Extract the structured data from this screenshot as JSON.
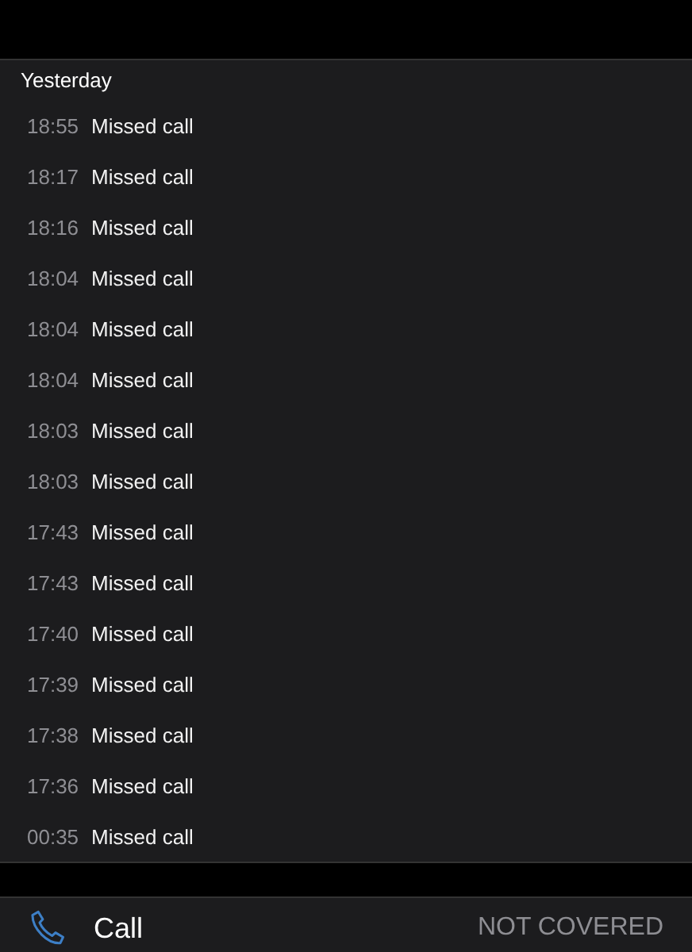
{
  "section": {
    "title": "Yesterday",
    "calls": [
      {
        "time": "18:55",
        "label": "Missed call"
      },
      {
        "time": "18:17",
        "label": "Missed call"
      },
      {
        "time": "18:16",
        "label": "Missed call"
      },
      {
        "time": "18:04",
        "label": "Missed call"
      },
      {
        "time": "18:04",
        "label": "Missed call"
      },
      {
        "time": "18:04",
        "label": "Missed call"
      },
      {
        "time": "18:03",
        "label": "Missed call"
      },
      {
        "time": "18:03",
        "label": "Missed call"
      },
      {
        "time": "17:43",
        "label": "Missed call"
      },
      {
        "time": "17:43",
        "label": "Missed call"
      },
      {
        "time": "17:40",
        "label": "Missed call"
      },
      {
        "time": "17:39",
        "label": "Missed call"
      },
      {
        "time": "17:38",
        "label": "Missed call"
      },
      {
        "time": "17:36",
        "label": "Missed call"
      },
      {
        "time": "00:35",
        "label": "Missed call"
      }
    ]
  },
  "action_bar": {
    "label": "Call",
    "status": "NOT COVERED"
  }
}
